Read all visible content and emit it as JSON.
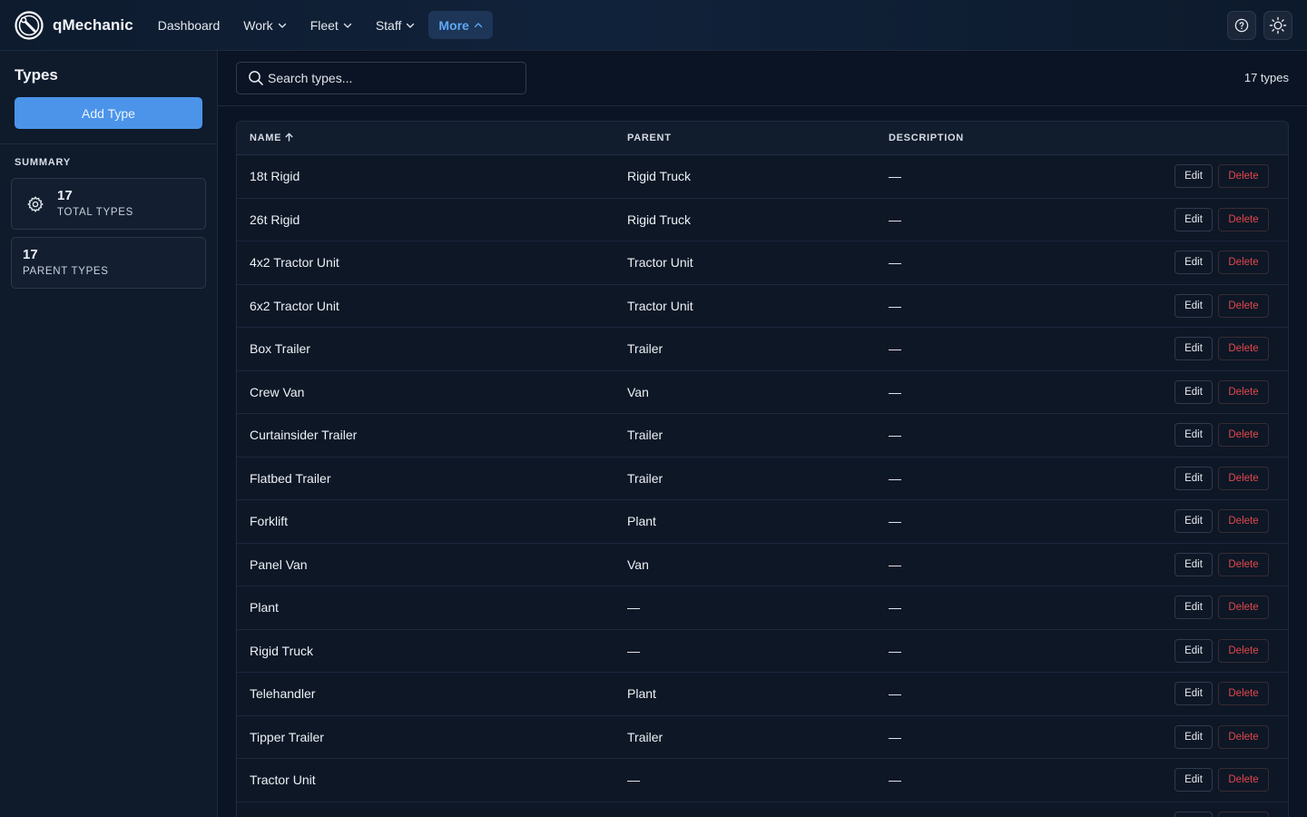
{
  "app": {
    "name": "qMechanic"
  },
  "nav": [
    {
      "label": "Dashboard",
      "dropdown": false,
      "active": false
    },
    {
      "label": "Work",
      "dropdown": true,
      "active": false
    },
    {
      "label": "Fleet",
      "dropdown": true,
      "active": false
    },
    {
      "label": "Staff",
      "dropdown": true,
      "active": false
    },
    {
      "label": "More",
      "dropdown": true,
      "active": true
    }
  ],
  "topbar_icons": [
    "help-icon",
    "theme-sun-icon"
  ],
  "sidebar": {
    "title": "Types",
    "add_button": "Add Type",
    "summary_heading": "SUMMARY",
    "stats": [
      {
        "value": "17",
        "label": "TOTAL TYPES",
        "icon": "gear-icon"
      },
      {
        "value": "17",
        "label": "PARENT TYPES",
        "icon": ""
      }
    ]
  },
  "search": {
    "placeholder": "Search types..."
  },
  "count_text": "17 types",
  "table": {
    "headers": {
      "name": "NAME",
      "parent": "PARENT",
      "description": "DESCRIPTION"
    },
    "sort": {
      "column": "name",
      "direction": "asc"
    },
    "edit_label": "Edit",
    "delete_label": "Delete",
    "rows": [
      {
        "name": "18t Rigid",
        "parent": "Rigid Truck",
        "description": "—"
      },
      {
        "name": "26t Rigid",
        "parent": "Rigid Truck",
        "description": "—"
      },
      {
        "name": "4x2 Tractor Unit",
        "parent": "Tractor Unit",
        "description": "—"
      },
      {
        "name": "6x2 Tractor Unit",
        "parent": "Tractor Unit",
        "description": "—"
      },
      {
        "name": "Box Trailer",
        "parent": "Trailer",
        "description": "—"
      },
      {
        "name": "Crew Van",
        "parent": "Van",
        "description": "—"
      },
      {
        "name": "Curtainsider Trailer",
        "parent": "Trailer",
        "description": "—"
      },
      {
        "name": "Flatbed Trailer",
        "parent": "Trailer",
        "description": "—"
      },
      {
        "name": "Forklift",
        "parent": "Plant",
        "description": "—"
      },
      {
        "name": "Panel Van",
        "parent": "Van",
        "description": "—"
      },
      {
        "name": "Plant",
        "parent": "—",
        "description": "—"
      },
      {
        "name": "Rigid Truck",
        "parent": "—",
        "description": "—"
      },
      {
        "name": "Telehandler",
        "parent": "Plant",
        "description": "—"
      },
      {
        "name": "Tipper Trailer",
        "parent": "Trailer",
        "description": "—"
      },
      {
        "name": "Tractor Unit",
        "parent": "—",
        "description": "—"
      },
      {
        "name": "",
        "parent": "",
        "description": ""
      }
    ]
  },
  "colors": {
    "accent": "#4b94ea",
    "nav_active_text": "#5ea8f5",
    "delete_red": "#e0484b",
    "background": "#0b1424"
  }
}
